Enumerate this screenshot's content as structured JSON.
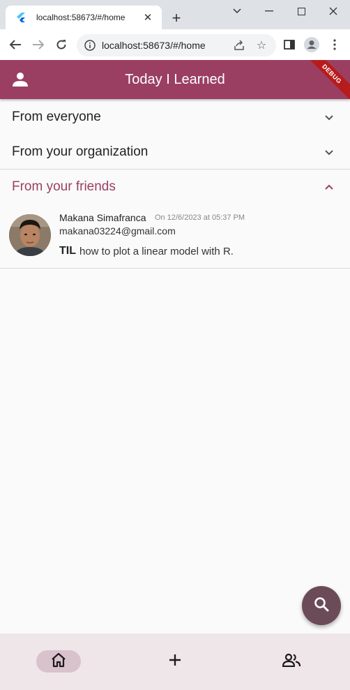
{
  "browser": {
    "tab_title": "localhost:58673/#/home",
    "url": "localhost:58673/#/home"
  },
  "app": {
    "title": "Today I Learned",
    "debug_label": "DEBUG"
  },
  "sections": [
    {
      "label": "From everyone",
      "expanded": false
    },
    {
      "label": "From your organization",
      "expanded": false
    },
    {
      "label": "From your friends",
      "expanded": true
    }
  ],
  "post": {
    "author": "Makana Simafranca",
    "date": "On 12/6/2023 at 05:37 PM",
    "email": "makana03224@gmail.com",
    "prefix": "TIL",
    "content": "how to plot a linear model with R."
  },
  "colors": {
    "primary": "#9a3f62",
    "fab": "#6c4b58",
    "nav_bg": "#efe6ea",
    "nav_active": "#d8c2cc"
  },
  "icons": {
    "account": "person-icon",
    "search": "search-icon",
    "home": "home-icon",
    "add": "add-icon",
    "friends": "people-icon"
  }
}
